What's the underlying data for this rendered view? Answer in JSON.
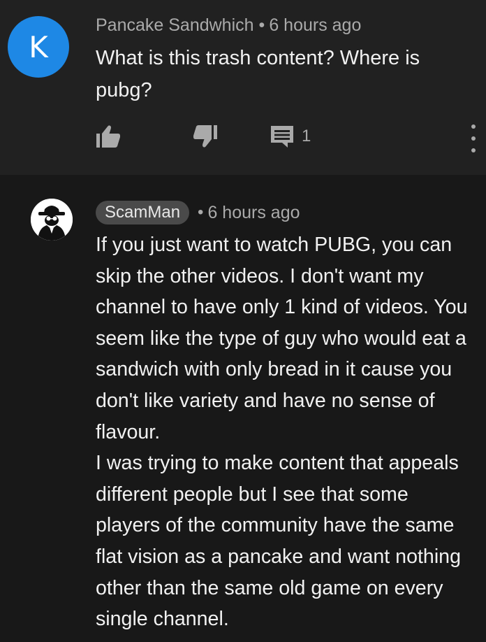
{
  "comment": {
    "avatar_letter": "K",
    "avatar_color": "#1e88e5",
    "author": "Pancake Sandwhich",
    "separator": "•",
    "time": "6 hours ago",
    "text": "What is this trash content? Where is pubg?",
    "reply_count": "1",
    "icons": [
      "thumbs-up-icon",
      "thumbs-down-icon",
      "reply-icon",
      "more-vert-icon"
    ]
  },
  "reply": {
    "avatar_icon": "spy-avatar-icon",
    "author": "ScamMan",
    "separator": "•",
    "time": "6 hours ago",
    "paragraph1": "If you just want to watch PUBG, you can skip the other videos. I don't want my channel to have only 1 kind of videos. You seem like the type of guy who would eat a sandwich with only bread in it cause you don't like variety and have no sense of flavour.",
    "paragraph2": "I was trying to make content that appeals different people but I see that some players of the community have the same flat vision as a pancake and want nothing other than the same old game on every single channel."
  }
}
